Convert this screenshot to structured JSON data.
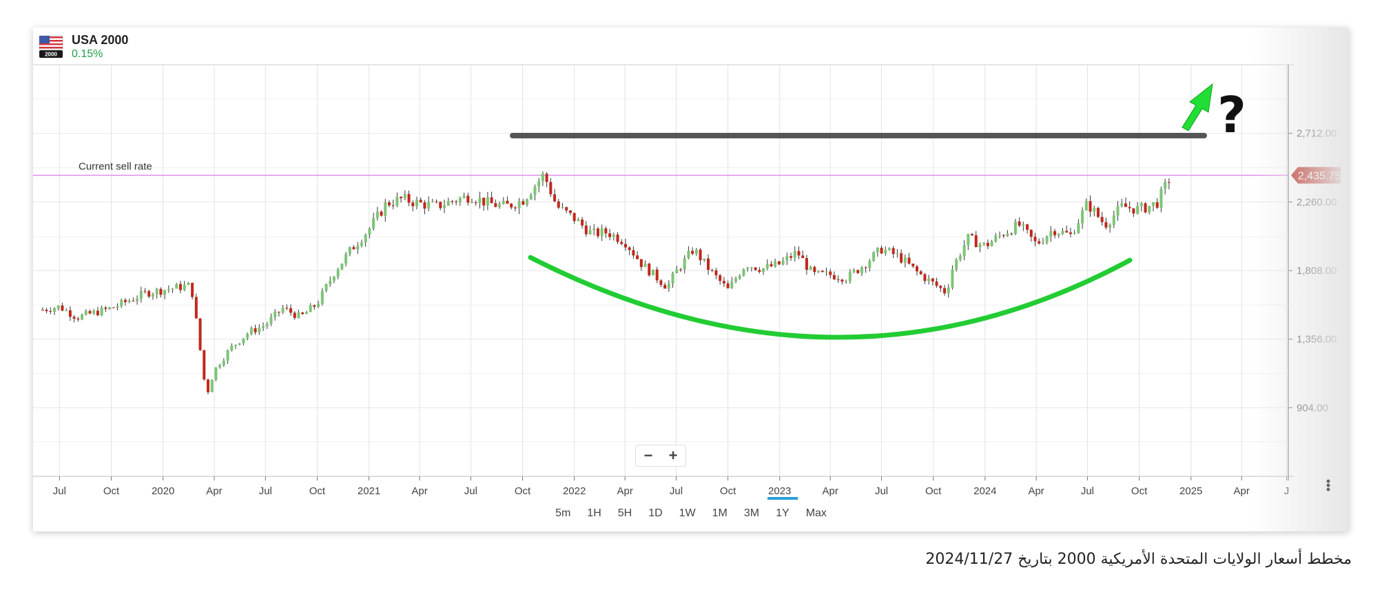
{
  "instrument": {
    "name": "USA 2000",
    "change": "0.15%",
    "flag_badge": "2000",
    "flag_icon": "us-flag-icon"
  },
  "sell_rate": {
    "label": "Current sell rate",
    "value": "2,435.75"
  },
  "zoom": {
    "minus": "−",
    "plus": "+"
  },
  "periods": [
    "5m",
    "1H",
    "5H",
    "1D",
    "1W",
    "1M",
    "3M",
    "1Y",
    "Max"
  ],
  "active_period": "1Y",
  "annotations": {
    "question": "?"
  },
  "caption": "مخطط أسعار الولايات المتحدة الأمريكية 2000 بتاريخ 2024/11/27",
  "colors": {
    "up": "#7cc576",
    "down": "#c0281c",
    "sell_line": "#e08ce8",
    "resistance": "#555555",
    "cup": "#22cc33",
    "arrow": "#22dd33",
    "price_tag": "#b8281c"
  },
  "chart_data": {
    "type": "candlestick",
    "title": "USA 2000",
    "ylim": [
      452,
      3164
    ],
    "y_ticks": [
      "904.00",
      "1,356.00",
      "1,808.00",
      "2,260.00",
      "2,712.00"
    ],
    "y_tick_values": [
      904,
      1356,
      1808,
      2260,
      2712
    ],
    "x_ticks": [
      "Jul",
      "Oct",
      "2020",
      "Apr",
      "Jul",
      "Oct",
      "2021",
      "Apr",
      "Jul",
      "Oct",
      "2022",
      "Apr",
      "Jul",
      "Oct",
      "2023",
      "Apr",
      "Jul",
      "Oct",
      "2024",
      "Apr",
      "Jul",
      "Oct",
      "2025",
      "Apr",
      "J"
    ],
    "current_sell_rate": 2435.75,
    "close_path": [
      [
        "2019-06-01",
        1550
      ],
      [
        "2019-07-01",
        1570
      ],
      [
        "2019-08-01",
        1500
      ],
      [
        "2019-09-01",
        1530
      ],
      [
        "2019-10-01",
        1560
      ],
      [
        "2019-11-01",
        1610
      ],
      [
        "2019-12-01",
        1660
      ],
      [
        "2020-01-01",
        1680
      ],
      [
        "2020-02-01",
        1700
      ],
      [
        "2020-02-20",
        1710
      ],
      [
        "2020-03-01",
        1450
      ],
      [
        "2020-03-18",
        980
      ],
      [
        "2020-04-01",
        1150
      ],
      [
        "2020-05-01",
        1300
      ],
      [
        "2020-06-01",
        1400
      ],
      [
        "2020-07-01",
        1450
      ],
      [
        "2020-08-01",
        1560
      ],
      [
        "2020-09-01",
        1500
      ],
      [
        "2020-10-01",
        1590
      ],
      [
        "2020-11-01",
        1800
      ],
      [
        "2020-12-01",
        1950
      ],
      [
        "2021-01-01",
        2080
      ],
      [
        "2021-02-01",
        2250
      ],
      [
        "2021-03-01",
        2280
      ],
      [
        "2021-04-01",
        2250
      ],
      [
        "2021-05-01",
        2230
      ],
      [
        "2021-06-01",
        2270
      ],
      [
        "2021-07-01",
        2300
      ],
      [
        "2021-08-01",
        2250
      ],
      [
        "2021-09-01",
        2230
      ],
      [
        "2021-10-01",
        2270
      ],
      [
        "2021-11-08",
        2440
      ],
      [
        "2021-12-01",
        2230
      ],
      [
        "2022-01-01",
        2150
      ],
      [
        "2022-02-01",
        2050
      ],
      [
        "2022-03-01",
        2060
      ],
      [
        "2022-04-01",
        2000
      ],
      [
        "2022-05-01",
        1850
      ],
      [
        "2022-06-15",
        1700
      ],
      [
        "2022-07-01",
        1800
      ],
      [
        "2022-08-01",
        1950
      ],
      [
        "2022-09-01",
        1800
      ],
      [
        "2022-10-01",
        1680
      ],
      [
        "2022-11-01",
        1850
      ],
      [
        "2022-12-01",
        1820
      ],
      [
        "2023-01-01",
        1850
      ],
      [
        "2023-02-01",
        1930
      ],
      [
        "2023-03-01",
        1780
      ],
      [
        "2023-04-01",
        1780
      ],
      [
        "2023-05-01",
        1760
      ],
      [
        "2023-06-01",
        1850
      ],
      [
        "2023-07-01",
        1950
      ],
      [
        "2023-08-01",
        1900
      ],
      [
        "2023-09-01",
        1800
      ],
      [
        "2023-10-25",
        1660
      ],
      [
        "2023-11-01",
        1800
      ],
      [
        "2023-12-01",
        2020
      ],
      [
        "2024-01-01",
        1970
      ],
      [
        "2024-02-01",
        2050
      ],
      [
        "2024-03-01",
        2110
      ],
      [
        "2024-04-01",
        1980
      ],
      [
        "2024-05-01",
        2080
      ],
      [
        "2024-06-01",
        2040
      ],
      [
        "2024-07-01",
        2250
      ],
      [
        "2024-08-01",
        2110
      ],
      [
        "2024-09-01",
        2230
      ],
      [
        "2024-10-01",
        2210
      ],
      [
        "2024-11-01",
        2250
      ],
      [
        "2024-11-27",
        2435
      ]
    ]
  }
}
